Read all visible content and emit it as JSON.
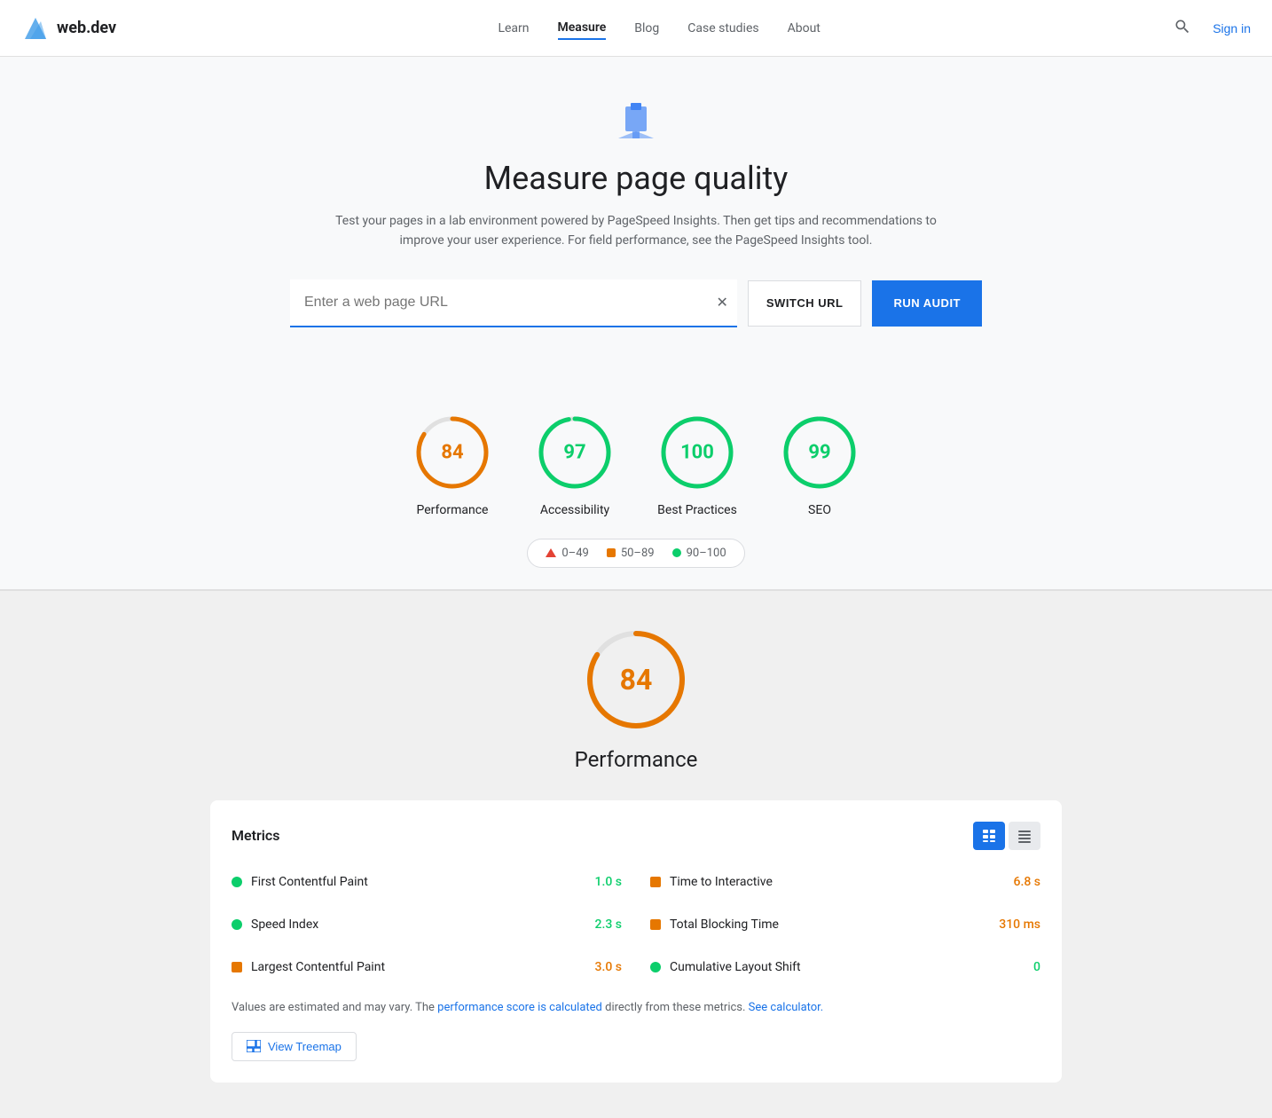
{
  "nav": {
    "logo_text": "web.dev",
    "links": [
      {
        "label": "Learn",
        "active": false
      },
      {
        "label": "Measure",
        "active": true
      },
      {
        "label": "Blog",
        "active": false
      },
      {
        "label": "Case studies",
        "active": false
      },
      {
        "label": "About",
        "active": false
      }
    ],
    "sign_in": "Sign in"
  },
  "hero": {
    "title": "Measure page quality",
    "description": "Test your pages in a lab environment powered by PageSpeed Insights. Then get tips and recommendations to improve your user experience. For field performance, see the PageSpeed Insights tool."
  },
  "url_input": {
    "placeholder": "Enter a web page URL",
    "switch_url_label": "SWITCH URL",
    "run_audit_label": "RUN AUDIT"
  },
  "scores": [
    {
      "value": 84,
      "label": "Performance",
      "color": "orange",
      "percent": 84
    },
    {
      "value": 97,
      "label": "Accessibility",
      "color": "green",
      "percent": 97
    },
    {
      "value": 100,
      "label": "Best Practices",
      "color": "green",
      "percent": 100
    },
    {
      "value": 99,
      "label": "SEO",
      "color": "green",
      "percent": 99
    }
  ],
  "legend": [
    {
      "range": "0–49",
      "type": "triangle",
      "color": "#e34234"
    },
    {
      "range": "50–89",
      "type": "square",
      "color": "#e67700"
    },
    {
      "range": "90–100",
      "type": "dot",
      "color": "#0cce6b"
    }
  ],
  "performance": {
    "score": 84,
    "title": "Performance",
    "metrics_title": "Metrics",
    "metrics": [
      {
        "name": "First Contentful Paint",
        "value": "1.0 s",
        "color_class": "val-green",
        "dot_color": "#0cce6b",
        "dot_type": "dot"
      },
      {
        "name": "Speed Index",
        "value": "2.3 s",
        "color_class": "val-green",
        "dot_color": "#0cce6b",
        "dot_type": "dot"
      },
      {
        "name": "Largest Contentful Paint",
        "value": "3.0 s",
        "color_class": "val-orange",
        "dot_color": "#e67700",
        "dot_type": "square"
      },
      {
        "name": "Time to Interactive",
        "value": "6.8 s",
        "color_class": "val-orange",
        "dot_color": "#e67700",
        "dot_type": "square"
      },
      {
        "name": "Total Blocking Time",
        "value": "310 ms",
        "color_class": "val-orange",
        "dot_color": "#e67700",
        "dot_type": "square"
      },
      {
        "name": "Cumulative Layout Shift",
        "value": "0",
        "color_class": "val-green",
        "dot_color": "#0cce6b",
        "dot_type": "dot"
      }
    ],
    "note_text": "Values are estimated and may vary. The ",
    "note_link1": "performance score is calculated",
    "note_link1_url": "#",
    "note_mid": " directly from these metrics. ",
    "note_link2": "See calculator.",
    "note_link2_url": "#",
    "treemap_btn": "View Treemap"
  }
}
